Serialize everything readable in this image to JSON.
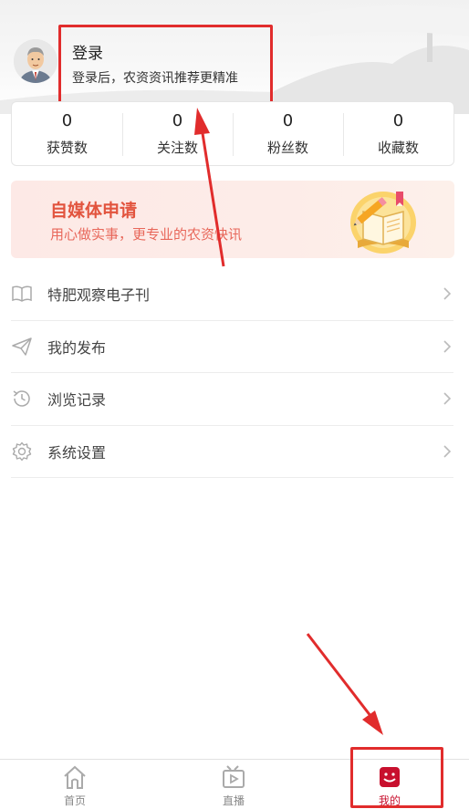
{
  "profile": {
    "login_title": "登录",
    "login_subtitle": "登录后，农资资讯推荐更精准"
  },
  "stats": [
    {
      "value": "0",
      "label": "获赞数"
    },
    {
      "value": "0",
      "label": "关注数"
    },
    {
      "value": "0",
      "label": "粉丝数"
    },
    {
      "value": "0",
      "label": "收藏数"
    }
  ],
  "banner": {
    "title": "自媒体申请",
    "subtitle": "用心做实事，更专业的农资快讯"
  },
  "menu": [
    {
      "label": "特肥观察电子刊",
      "icon": "book-icon"
    },
    {
      "label": "我的发布",
      "icon": "paper-plane-icon"
    },
    {
      "label": "浏览记录",
      "icon": "history-icon"
    },
    {
      "label": "系统设置",
      "icon": "gear-icon"
    }
  ],
  "tabbar": {
    "items": [
      {
        "label": "首页",
        "icon": "home-icon",
        "active": false
      },
      {
        "label": "直播",
        "icon": "live-icon",
        "active": false
      },
      {
        "label": "我的",
        "icon": "profile-icon",
        "active": true
      }
    ]
  },
  "colors": {
    "accent": "#c8102e",
    "annotation": "#e12c2c",
    "banner_text": "#e2543e"
  }
}
